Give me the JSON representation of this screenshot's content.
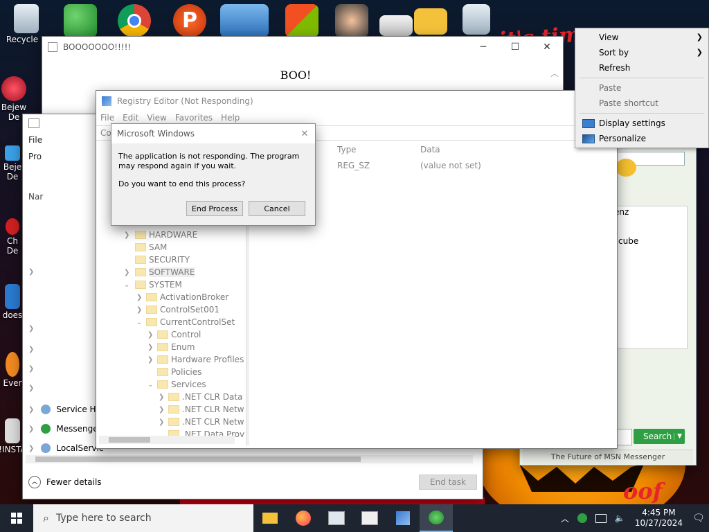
{
  "desktop": {
    "wallpaper_text_top": "it's time",
    "wallpaper_text_bottom": "oof",
    "icons_left": [
      {
        "label": "Recycle B"
      },
      {
        "label": "Bejew\nDe"
      },
      {
        "label": "Beje\nDe"
      },
      {
        "label": "Ch\nDe"
      },
      {
        "label": "does"
      },
      {
        "label": "Ever"
      },
      {
        "label": "!INSTA"
      }
    ],
    "top_icons": [
      "people-icon",
      "chrome-icon",
      "p-app-icon",
      "computers-icon",
      "windows-store-icon",
      "ninja-icon",
      "drive-icon",
      "folder-icon",
      "recycle-icon"
    ]
  },
  "boo_window": {
    "title": "BOOOOOOO!!!!!",
    "body": "BOO!"
  },
  "task_manager": {
    "menu_file": "File",
    "tab_processes": "Pro",
    "col_name": "Nar",
    "rows": [
      {
        "label": "Service Ho"
      },
      {
        "label": "Messenge"
      },
      {
        "label": "LocalServic"
      }
    ],
    "fewer_details": "Fewer details",
    "end_task": "End task"
  },
  "registry": {
    "title": "Registry Editor (Not Responding)",
    "menu": [
      "File",
      "Edit",
      "View",
      "Favorites",
      "Help"
    ],
    "address_prefix": "Co",
    "col_type": "Type",
    "col_data": "Data",
    "row_type": "REG_SZ",
    "row_data": "(value not set)",
    "tree": [
      {
        "label": "HARDWARE",
        "level": 1
      },
      {
        "label": "SAM",
        "level": 1
      },
      {
        "label": "SECURITY",
        "level": 1
      },
      {
        "label": "SOFTWARE",
        "level": 1
      },
      {
        "label": "SYSTEM",
        "level": 1
      },
      {
        "label": "ActivationBroker",
        "level": 2
      },
      {
        "label": "ControlSet001",
        "level": 2
      },
      {
        "label": "CurrentControlSet",
        "level": 2
      },
      {
        "label": "Control",
        "level": 3
      },
      {
        "label": "Enum",
        "level": 3
      },
      {
        "label": "Hardware Profiles",
        "level": 3
      },
      {
        "label": "Policies",
        "level": 3
      },
      {
        "label": "Services",
        "level": 3
      },
      {
        "label": ".NET CLR Data",
        "level": 4
      },
      {
        "label": ".NET CLR Netw",
        "level": 4
      },
      {
        "label": ".NET CLR Netw",
        "level": 4
      },
      {
        "label": ".NET Data Prov",
        "level": 4
      }
    ]
  },
  "dialog": {
    "title": "Microsoft Windows",
    "message": "The application is not responding. The program may respond again if you wait.",
    "question": "Do you want to end this process?",
    "end_process": "End Process",
    "cancel": "Cancel"
  },
  "messenger": {
    "text_1": "enz",
    "text_2": "cube",
    "search_btn": "Search",
    "footer": "The Future of MSN Messenger"
  },
  "context_menu": {
    "view": "View",
    "sort_by": "Sort by",
    "refresh": "Refresh",
    "paste": "Paste",
    "paste_shortcut": "Paste shortcut",
    "display_settings": "Display settings",
    "personalize": "Personalize"
  },
  "taskbar": {
    "search_placeholder": "Type here to search",
    "time": "4:45 PM",
    "date": "10/27/2024"
  },
  "colors": {
    "accent_green": "#2ea043",
    "taskbar": "#1f2530",
    "pumpkin": "#f08a00"
  }
}
